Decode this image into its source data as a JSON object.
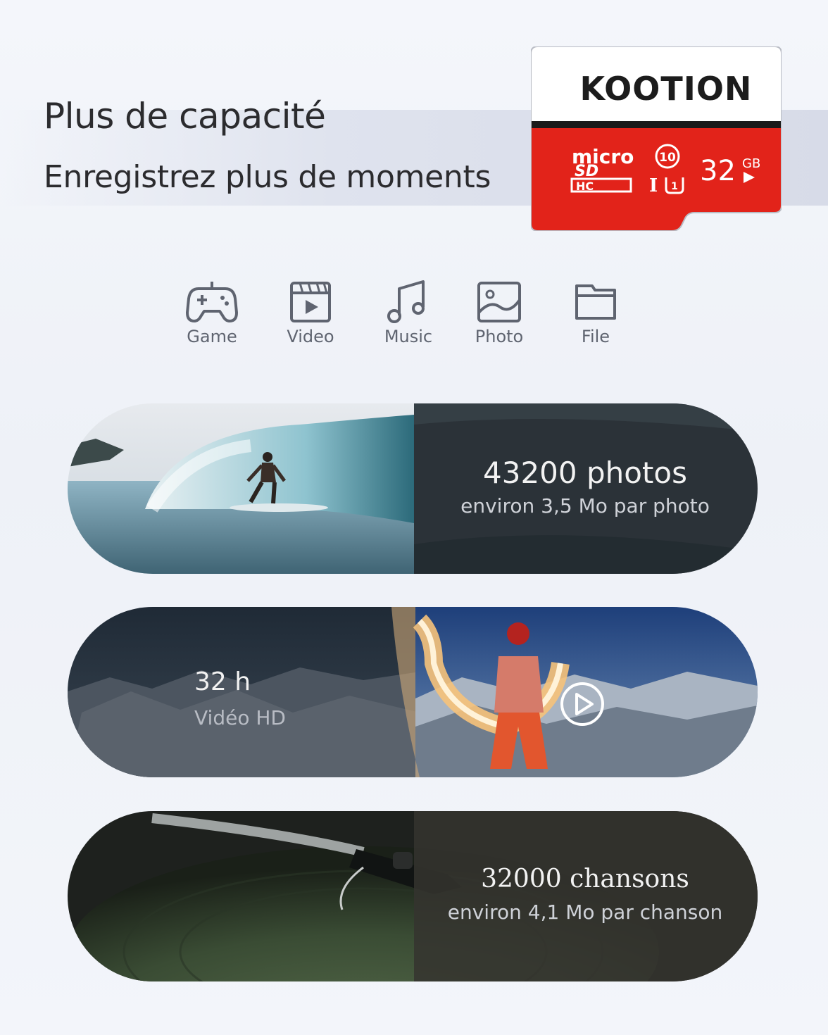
{
  "header": {
    "title": "Plus de capacité",
    "subtitle": "Enregistrez plus de moments"
  },
  "card": {
    "brand": "KOOTION",
    "capacity": "32",
    "unit": "GB",
    "micro": "micro",
    "speed_class": "10",
    "bus": "I",
    "uhs": "1",
    "colors": {
      "red": "#e2231a",
      "white": "#ffffff",
      "dark": "#1a1a1a"
    }
  },
  "categories": [
    {
      "label": "Game",
      "icon": "gamepad-icon"
    },
    {
      "label": "Video",
      "icon": "video-clapper-icon"
    },
    {
      "label": "Music",
      "icon": "music-note-icon"
    },
    {
      "label": "Photo",
      "icon": "photo-icon"
    },
    {
      "label": "File",
      "icon": "folder-icon"
    }
  ],
  "stats": {
    "photos": {
      "value": "43200 photos",
      "note": "environ 3,5 Mo par photo"
    },
    "video": {
      "value": "32 h",
      "note": "Vidéo HD"
    },
    "songs": {
      "value": "32000 chansons",
      "note": "environ 4,1 Mo par chanson"
    }
  },
  "colors": {
    "text_dark": "#2b2b2e",
    "icon_gray": "#5f6470",
    "pill_dark": "#2e353d"
  }
}
